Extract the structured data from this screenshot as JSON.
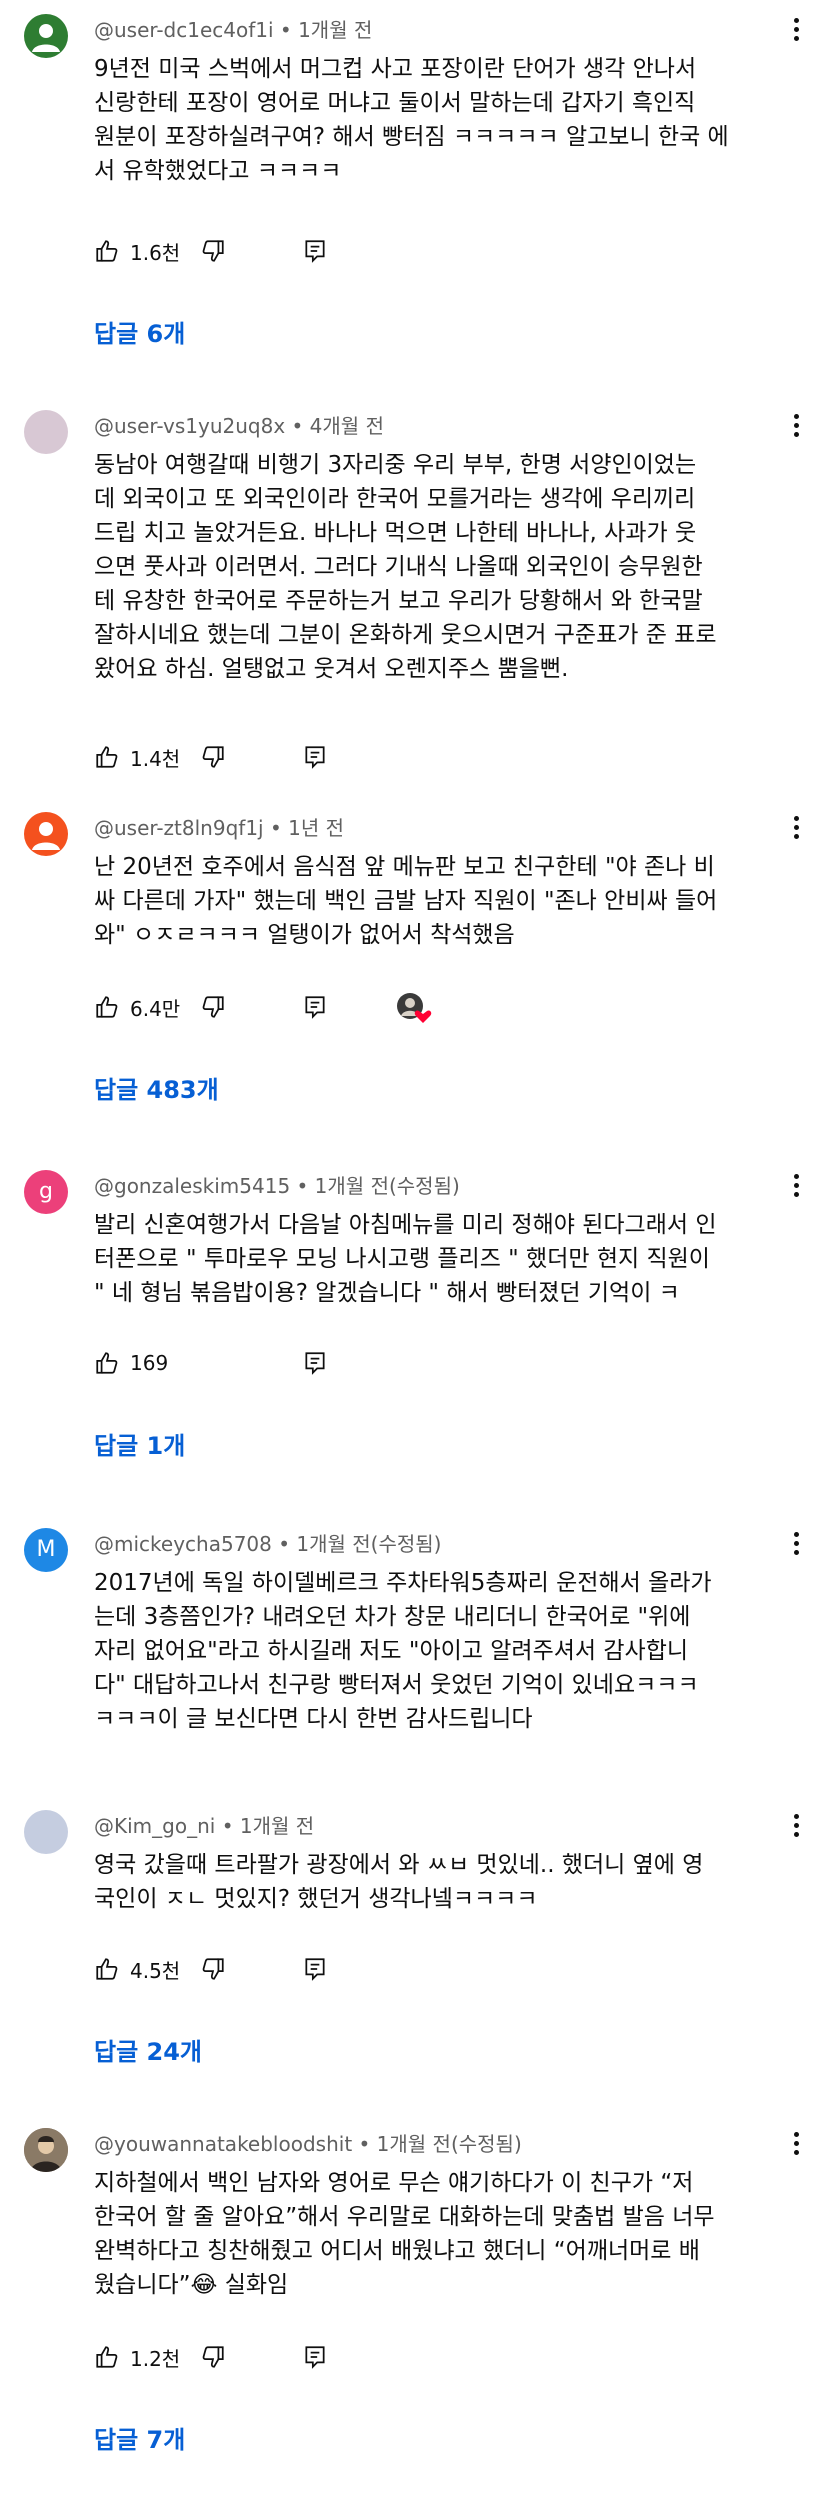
{
  "comments": [
    {
      "author": "@user-dc1ec4of1i",
      "time": "• 1개월 전",
      "avatar_color": "#2e7d32",
      "avatar_icon": "user-silhouette-icon",
      "text": "9년전 미국 스벅에서 머그컵 사고 포장이란 단어가 생각 안나서\n신랑한테 포장이 영어로 머냐고 둘이서 말하는데  갑자기 흑인직\n원분이 포장하실려구여? 해서 빵터짐 ㅋㅋㅋㅋㅋ 알고보니 한국 에\n서 유학했었다고 ㅋㅋㅋㅋ",
      "likes": "1.6천",
      "replies": "답글 6개"
    },
    {
      "author": "@user-vs1yu2uq8x",
      "time": "• 4개월 전",
      "avatar_color": "#d8c8d4",
      "avatar_icon": "",
      "text": "동남아 여행갈때 비행기 3자리중 우리 부부, 한명 서양인이었는\n데 외국이고 또 외국인이라 한국어 모를거라는 생각에 우리끼리\n드립 치고 놀았거든요.  바나나 먹으면 나한테 바나나, 사과가 웃\n으면 풋사과 이러면서.  그러다 기내식 나올때 외국인이 승무원한\n테 유창한 한국어로  주문하는거 보고 우리가 당황해서 와 한국말\n잘하시네요 했는데 그분이 온화하게 웃으시면거 구준표가 준 표로\n왔어요 하심.  얼탱없고 웃겨서 오렌지주스 뿜을뻔.",
      "likes": "1.4천",
      "replies": ""
    },
    {
      "author": "@user-zt8ln9qf1j",
      "time": "• 1년 전",
      "avatar_color": "#f4511e",
      "avatar_icon": "user-silhouette-icon",
      "text": "난 20년전 호주에서 음식점 앞 메뉴판 보고 친구한테 \"야 존나 비\n싸 다른데 가자\" 했는데 백인 금발 남자 직원이 \"존나 안비싸 들어\n와\" ㅇㅈㄹㅋㅋㅋ 얼탱이가 없어서 착석했음",
      "likes": "6.4만",
      "replies": "답글 483개"
    },
    {
      "author": "@gonzaleskim5415",
      "time": "• 1개월 전(수정됨)",
      "avatar_color": "#ec407a",
      "avatar_icon": "",
      "avatar_letter": "g",
      "text": "발리 신혼여행가서 다음날 아침메뉴를 미리 정해야 된다그래서 인\n터폰으로 \" 투마로우 모닝 나시고랭 플리즈 \" 했더만 현지 직원이\n\" 네 형님 볶음밥이용? 알겠습니다 \" 해서 빵터졌던 기억이 ㅋ",
      "likes": "169",
      "replies": "답글 1개"
    },
    {
      "author": "@mickeycha5708",
      "time": "• 1개월 전(수정됨)",
      "avatar_color": "#1e88e5",
      "avatar_icon": "",
      "avatar_letter": "M",
      "text": "2017년에 독일 하이델베르크 주차타워5층짜리 운전해서 올라가\n는데 3층쯤인가? 내려오던 차가 창문 내리더니 한국어로 \"위에\n자리 없어요\"라고 하시길래 저도 \"아이고 알려주셔서 감사합니\n다\" 대답하고나서 친구랑 빵터져서 웃었던 기억이 있네요ㅋㅋㅋ\nㅋㅋㅋ이 글 보신다면 다시 한번 감사드립니다",
      "likes": "",
      "replies": ""
    },
    {
      "author": "@Kim_go_ni",
      "time": "• 1개월 전",
      "avatar_color": "#c5cde0",
      "avatar_icon": "",
      "text": "영국 갔을때 트라팔가 광장에서 와 ㅆㅂ 멋있네.. 했더니 옆에 영\n국인이 ㅈㄴ 멋있지? 했던거 생각나넼ㅋㅋㅋㅋ",
      "likes": "4.5천",
      "replies": "답글 24개"
    },
    {
      "author": "@youwannatakebloodshit",
      "time": "• 1개월 전(수정됨)",
      "avatar_color": "#6b5a4a",
      "avatar_icon": "profile-photo-icon",
      "text": "지하철에서 백인 남자와 영어로 무슨 얘기하다가 이 친구가 “저\n한국어 할 줄 알아요”해서 우리말로 대화하는데 맞춤법 발음 너무\n완벽하다고 칭찬해줬고 어디서 배웠냐고 했더니 “어깨너머로 배\n웠습니다”😂 실화임",
      "likes": "1.2천",
      "replies": "답글 7개"
    }
  ],
  "icons": {
    "like": "thumbs-up-icon",
    "dislike": "thumbs-down-icon",
    "reply": "reply-icon",
    "more": "more-vert-icon",
    "creator_heart": "creator-heart-avatar-icon"
  },
  "colors": {
    "replies_link": "#065fd4",
    "meta_text": "#606060",
    "heart": "#ff0033"
  }
}
